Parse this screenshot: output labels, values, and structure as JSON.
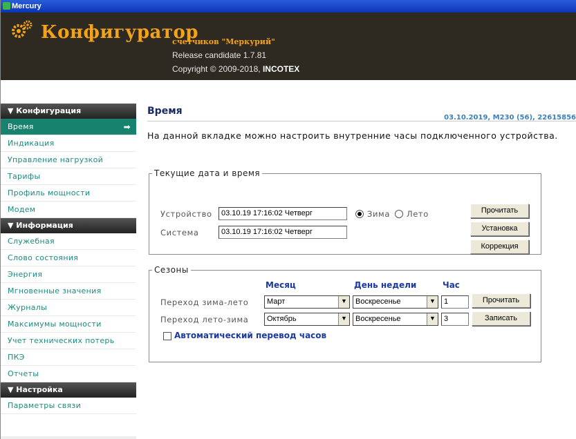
{
  "window": {
    "title": "Mercury"
  },
  "header": {
    "brand": "Конфигуратор",
    "subtitle": "счетчиков \"Меркурий\"",
    "release": "Release candidate 1.7.81",
    "copyright_prefix": "Copyright © 2009-2018,",
    "copyright_company": "INCOTEX",
    "accent_color": "#f2a31a"
  },
  "sidebar": {
    "sections": [
      {
        "title": "▼ Конфигурация",
        "items": [
          "Время",
          "Индикация",
          "Управление нагрузкой",
          "Тарифы",
          "Профиль мощности",
          "Модем"
        ]
      },
      {
        "title": "▼ Информация",
        "items": [
          "Служебная",
          "Слово состояния",
          "Энергия",
          "Мгновенные значения",
          "Журналы",
          "Максимумы мощности",
          "Учет технических потерь",
          "ПКЭ",
          "Отчеты"
        ]
      },
      {
        "title": "▼ Настройка",
        "items": [
          "Параметры связи"
        ]
      }
    ],
    "active_item": "Время",
    "active_color": "#17836f",
    "link_color": "#1a8a80"
  },
  "content": {
    "title": "Время",
    "meta": "03.10.2019, M230 (56), 22615856",
    "description": "На данной вкладке можно настроить внутренние часы подключенного устройства.",
    "datetime": {
      "legend": "Текущие дата и время",
      "device_label": "Устройство",
      "device_value": "03.10.19  17:16:02  Четверг",
      "system_label": "Система",
      "system_value": "03.10.19  17:16:02  Четверг",
      "winter_label": "Зима",
      "summer_label": "Лето",
      "season_selected": "Зима",
      "read_button": "Прочитать",
      "set_button": "Установка",
      "correct_button": "Коррекция"
    },
    "seasons": {
      "legend": "Сезоны",
      "col_month": "Месяц",
      "col_weekday": "День недели",
      "col_hour": "Час",
      "rows": [
        {
          "label": "Переход зима-лето",
          "month": "Март",
          "weekday": "Воскресенье",
          "hour": "1"
        },
        {
          "label": "Переход лето-зима",
          "month": "Октябрь",
          "weekday": "Воскресенье",
          "hour": "3"
        }
      ],
      "read_button": "Прочитать",
      "write_button": "Записать",
      "auto_label": "Автоматический перевод часов",
      "auto_checked": false
    }
  }
}
